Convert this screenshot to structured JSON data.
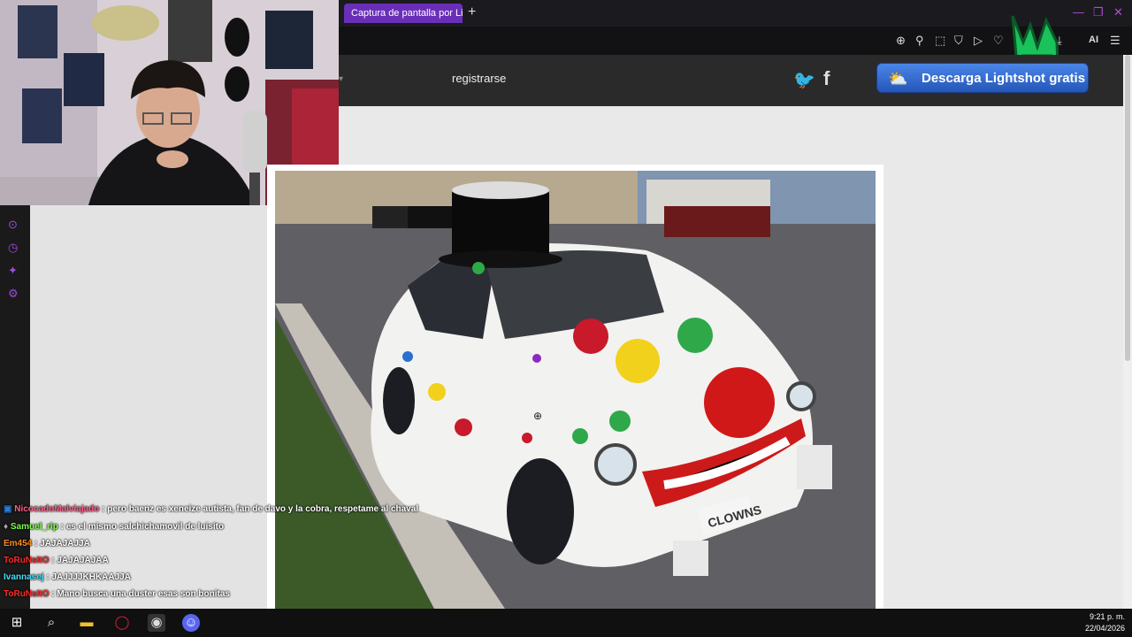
{
  "browser": {
    "tab_title": "Captura de pantalla por Li",
    "new_tab_symbol": "+",
    "toolbar_ai_label": "AI"
  },
  "site": {
    "nav_register": "registrarse",
    "download_button": "Descarga Lightshot gratis"
  },
  "photo": {
    "plate_text": "CLOWNS"
  },
  "chat": [
    {
      "user": "NicocadoMalviajado",
      "user_color": "#ff5c8a",
      "message": ": pero baenz es xeneize autista, fan de davo y la cobra, respetame al chaval",
      "prefix": "▣"
    },
    {
      "user": "Samuel_rip",
      "user_color": "#7cff4d",
      "message": ": es el mismo salchichamovil de luisito",
      "prefix": "♦"
    },
    {
      "user": "Em454",
      "user_color": "#ff8c1a",
      "message": ": JAJAJAJJA",
      "prefix": ""
    },
    {
      "user": "ToRuNsItO",
      "user_color": "#ff2a2a",
      "message": ": JAJAJAJAA",
      "prefix": ""
    },
    {
      "user": "Ivannasej",
      "user_color": "#40e0ff",
      "message": ": JAJJJJKHKAAJJA",
      "prefix": ""
    },
    {
      "user": "ToRuNsItO",
      "user_color": "#ff2a2a",
      "message": ": Mano busca una duster esas son bonitas",
      "prefix": ""
    }
  ],
  "taskbar": {
    "time": "9:21 p. m.",
    "date": "22/04/2026"
  },
  "icons": [
    "windows-start-icon",
    "search-icon",
    "folder-icon",
    "opera-gx-icon",
    "obs-icon",
    "discord-icon",
    "zoom-in-icon",
    "pin-icon",
    "crop-icon",
    "shield-icon",
    "play-icon",
    "heart-icon",
    "download-icon",
    "menu-icon",
    "twitter-icon",
    "facebook-icon"
  ],
  "colors": {
    "accent": "#6a2fb8",
    "sidebar_icon": "#9b4dd8",
    "download_button": "#3b6fd8"
  }
}
